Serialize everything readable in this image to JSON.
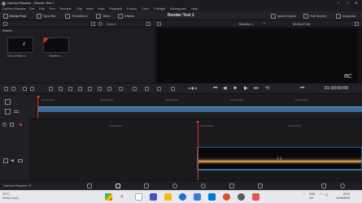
{
  "window": {
    "title": "DaVinci Resolve - Render Test 1",
    "controls": {
      "minimize": "–",
      "maximize": "□",
      "close": "✕"
    }
  },
  "menu": [
    "DaVinci Resolve",
    "File",
    "Edit",
    "Trim",
    "Timeline",
    "Clip",
    "Mark",
    "View",
    "Playback",
    "Fusion",
    "Color",
    "Fairlight",
    "Workspace",
    "Help"
  ],
  "toolbar": {
    "media_pool": "Media Pool",
    "sync_bin": "Sync Bin",
    "transitions": "Transitions",
    "titles": "Titles",
    "effects": "Effects",
    "project_title": "Render Test 1",
    "quick_export": "Quick Export",
    "full_screen": "Full Screen",
    "inspector": "Inspector"
  },
  "media_pool": {
    "search_label": "Search",
    "bin_name": "Master",
    "clips": [
      {
        "label": "DJI1 (1080p) N...",
        "badge": false
      },
      {
        "label": "Timeline 1",
        "badge": true
      }
    ]
  },
  "viewer": {
    "timeline_name": "Timeline 1",
    "timecode_top": "00:44:47:02",
    "watermark": "RC"
  },
  "transport": {
    "timecode": "01:00:00:00"
  },
  "upper_timeline": {
    "ruler_labels": [
      "01:00:00:00",
      "01:00:20:00",
      "01:00:40:00",
      "01:01:00:00",
      "01:01:20:00"
    ]
  },
  "lower_timeline": {
    "ruler_labels": [
      "00:59:58:00",
      "01:00:00:00",
      "01:00:02:00"
    ],
    "clip_icon": "[··]"
  },
  "page_bar": {
    "brand": "DaVinci Resolve 17"
  },
  "taskbar": {
    "weather_temp": "12°C",
    "weather_desc": "Mostly cloudy",
    "lang_top": "ENG",
    "lang_bottom": "US",
    "time": "18:12",
    "date": "11/03/2022",
    "colors": {
      "edge": "#1f6fd1",
      "folder": "#f2b91c",
      "store": "#3a7bd5",
      "mail": "#0078d4",
      "chrome": "#e04a3a",
      "resolve": "#5a5a62",
      "teams": "#5b5fc7",
      "music": "#e2554f"
    }
  }
}
